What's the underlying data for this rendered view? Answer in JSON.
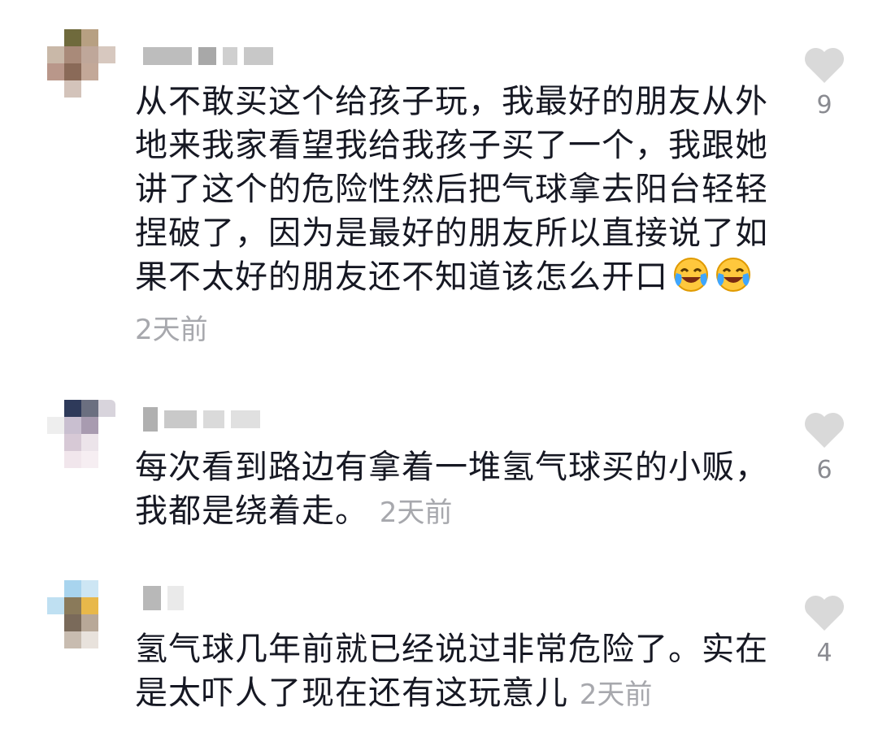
{
  "comments": [
    {
      "text": "从不敢买这个给孩子玩，我最好的朋友从外地来我家看望我给我孩子买了一个，我跟她讲了这个的危险性然后把气球拿去阳台轻轻捏破了，因为是最好的朋友所以直接说了如果不太好的朋友还不知道该怎么开口",
      "emoji": [
        "laughing-crying-emoji",
        "laughing-crying-emoji"
      ],
      "time": "2天前",
      "likes": "9"
    },
    {
      "text": "每次看到路边有拿着一堆氢气球买的小贩，我都是绕着走。",
      "time": "2天前",
      "likes": "6"
    },
    {
      "text": "氢气球几年前就已经说过非常危险了。实在是太吓人了现在还有这玩意儿",
      "time": "2天前",
      "likes": "4"
    }
  ],
  "colors": {
    "text": "#161823",
    "meta": "#a7a8ad",
    "heart": "#d9d9d9",
    "count": "#8a8b91"
  }
}
